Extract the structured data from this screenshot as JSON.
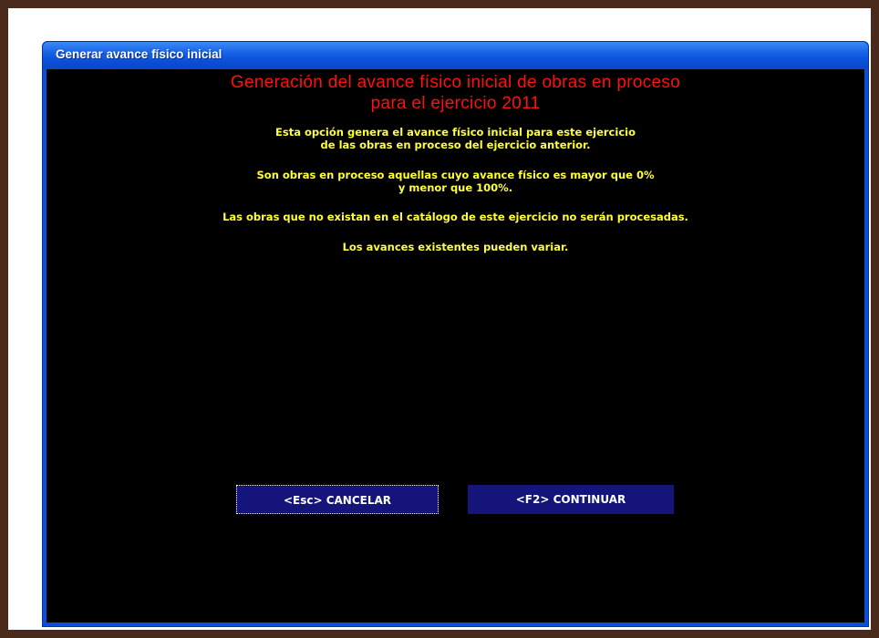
{
  "window": {
    "title": "Generar avance físico inicial"
  },
  "heading": {
    "line1": "Generación del avance físico inicial de obras en proceso",
    "line2": "para el ejercicio 2011"
  },
  "messages": {
    "p1_line1": "Esta opción genera el avance físico inicial para este ejercicio",
    "p1_line2": "de las obras en proceso del ejercicio anterior.",
    "p2_line1": "Son obras en proceso aquellas cuyo avance físico es mayor que 0%",
    "p2_line2": "y menor que 100%.",
    "p3": "Las obras que no existan en el catálogo de este ejercicio no serán procesadas.",
    "p4": "Los avances existentes pueden variar."
  },
  "buttons": {
    "cancel_label": "<Esc> CANCELAR",
    "continue_label": "<F2> CONTINUAR"
  },
  "colors": {
    "frame": "#4a2a1a",
    "titlebar": "#0a50d8",
    "client_bg": "#000000",
    "heading": "#ff1010",
    "message": "#ffff33",
    "button_bg": "#14147a"
  }
}
